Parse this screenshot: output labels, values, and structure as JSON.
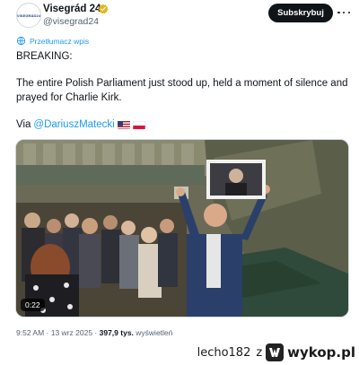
{
  "tweet": {
    "author": {
      "display_name": "Visegrád 24",
      "handle": "@visegrad24",
      "avatar_text": "VISEGRÁD24",
      "verified_icon": "verified-badge-icon",
      "verified_color": "#e2b719"
    },
    "subscribe_label": "Subskrybuj",
    "more_icon": "more-options-icon",
    "translate_icon": "translate-icon",
    "translate_label": "Przetłumacz wpis",
    "text_breaking": "BREAKING:",
    "text_body": "The entire Polish Parliament just stood up, held a moment of silence and prayed for Charlie Kirk.",
    "via_prefix": "Via",
    "via_mention": "@DariuszMatecki",
    "flags": [
      "us-flag-icon",
      "poland-flag-icon"
    ],
    "video": {
      "timer": "0:22"
    },
    "timestamp": "9:52 AM · 13 wrz 2025 ·",
    "views_count": "397,9 tys.",
    "views_label": "wyświetleń"
  },
  "watermark": {
    "user": "lecho182",
    "separator": "z",
    "site": "wykop.pl"
  },
  "colors": {
    "link": "#1d9bf0",
    "text": "#0f1419",
    "muted": "#536471",
    "button_bg": "#0f1419"
  }
}
